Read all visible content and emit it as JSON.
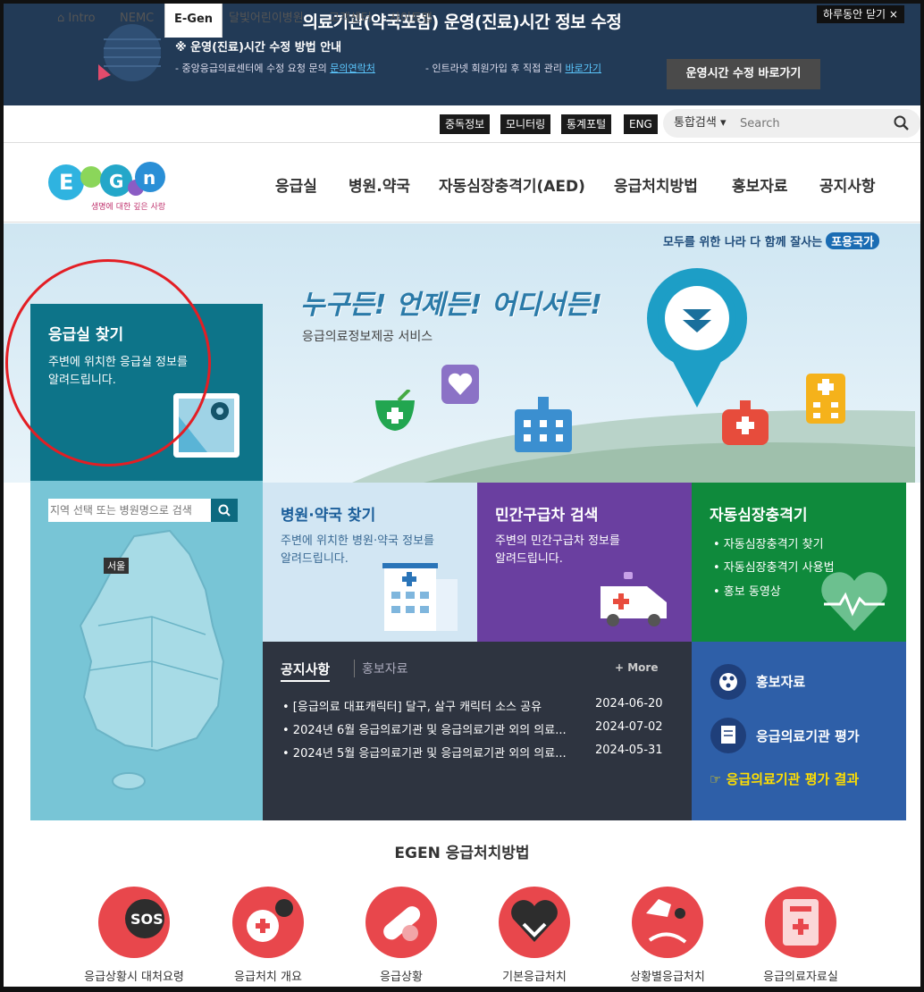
{
  "banner": {
    "title": "의료기관(약국포함) 운영(진료)시간 정보 수정",
    "guide": "※ 운영(진료)시간 수정 방법 안내",
    "line1_text": "- 중앙응급의료센터에 수정 요청 문의 ",
    "line1_link": "문의연락처",
    "line2_text": "- 인트라넷 회원가입 후 직접 관리 ",
    "line2_link": "바로가기",
    "button": "운영시간 수정 바로가기",
    "close": "하루동안 닫기 ×"
  },
  "util_nav": {
    "items": [
      "Intro",
      "NEMC",
      "E-Gen",
      "달빛어린이병원",
      "고객센터",
      "사이트맵"
    ],
    "black_items": [
      "중독정보",
      "모니터링",
      "통계포털",
      "ENG"
    ],
    "search_scope": "통합검색 ▾",
    "search_placeholder": "Search"
  },
  "logo": {
    "text": "E-Gen",
    "tagline": "생명에 대한 깊은 사랑"
  },
  "main_nav": [
    "응급실",
    "병원.약국",
    "자동심장충격기(AED)",
    "응급처치방법",
    "홍보자료",
    "공지사항"
  ],
  "hero": {
    "tag_text": "모두를 위한 나라 다 함께 잘사는",
    "tag_badge": "포용국가",
    "slogan": "누구든! 언제든! 어디서든!",
    "subtitle": "응급의료정보제공 서비스"
  },
  "er": {
    "title": "응급실 찾기",
    "desc1": "주변에 위치한 응급실 정보를",
    "desc2": "알려드립니다."
  },
  "map": {
    "search_placeholder": "지역 선택 또는 병원명으로 검색",
    "city": "서울"
  },
  "hospital": {
    "title": "병원·약국 찾기",
    "desc1": "주변에 위치한 병원·약국 정보를",
    "desc2": "알려드립니다."
  },
  "ambulance": {
    "title": "민간구급차 검색",
    "desc1": "주변의 민간구급차 정보를",
    "desc2": "알려드립니다."
  },
  "aed": {
    "title": "자동심장충격기",
    "items": [
      "• 자동심장충격기 찾기",
      "• 자동심장충격기 사용법",
      "• 홍보 동영상"
    ]
  },
  "notice": {
    "tab_active": "공지사항",
    "tab_other": "홍보자료",
    "more": "+ More",
    "rows": [
      {
        "title": "• [응급의료 대표캐릭터] 달구, 살구 캐릭터 소스 공유",
        "date": "2024-06-20"
      },
      {
        "title": "• 2024년 6월 응급의료기관 및 응급의료기관 외의 의료...",
        "date": "2024-07-02"
      },
      {
        "title": "• 2024년 5월 응급의료기관 및 응급의료기관 외의 의료...",
        "date": "2024-05-31"
      }
    ]
  },
  "promo": {
    "item1": "홍보자료",
    "item2": "응급의료기관 평가",
    "link": "☞ 응급의료기관 평가 결과"
  },
  "first_aid": {
    "title": "EGEN 응급처치방법",
    "items": [
      "응급상황시 대처요령",
      "응급처치 개요",
      "응급상황",
      "기본응급처치",
      "상황별응급처치",
      "응급의료자료실"
    ]
  },
  "colors": {
    "banner": "#223a56",
    "er": "#0d7489",
    "ambulance": "#6a3fa0",
    "aed": "#0f8a3c",
    "promo": "#2e5fa8",
    "notice": "#2e3440",
    "accent_red": "#e31e24"
  }
}
